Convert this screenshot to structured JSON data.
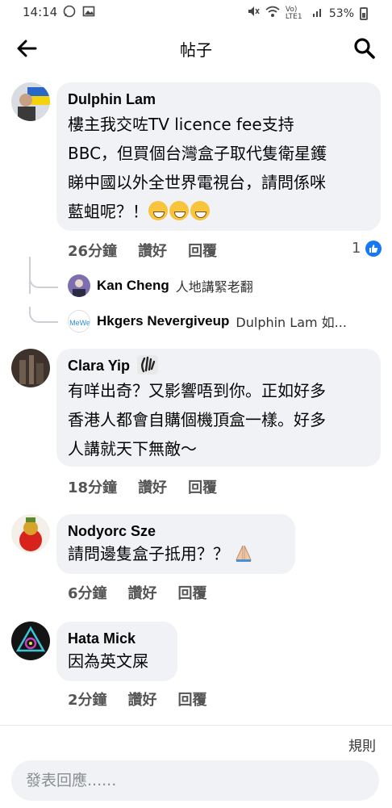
{
  "status_bar": {
    "time": "14:14",
    "network_label": "Vo) LTE1",
    "battery": "53%"
  },
  "header": {
    "title": "帖子"
  },
  "comments": [
    {
      "name": "Dulphin Lam",
      "text_lines": [
        "樓主我交咗TV licence fee支持",
        "BBC，但買個台灣盒子取代隻衛星鑊",
        "睇中國以外全世界電視台，請問係咪",
        "藍蛆呢？！"
      ],
      "time": "26分鐘",
      "like_label": "讚好",
      "reply_label": "回覆",
      "reaction_count": "1"
    },
    {
      "name": "Clara Yip",
      "text_lines": [
        "有咩出奇？又影響唔到你。正如好多",
        "香港人都會自購個機頂盒一樣。好多",
        "人講就天下無敵～"
      ],
      "time": "18分鐘",
      "like_label": "讚好",
      "reply_label": "回覆"
    },
    {
      "name": "Nodyorc Sze",
      "text_lines": [
        "請問邊隻盒子抵用？？"
      ],
      "time": "6分鐘",
      "like_label": "讚好",
      "reply_label": "回覆"
    },
    {
      "name": "Hata Mick",
      "text_lines": [
        "因為英文屎"
      ],
      "time": "2分鐘",
      "like_label": "讚好",
      "reply_label": "回覆"
    }
  ],
  "replies": [
    {
      "name": "Kan Cheng",
      "snippet": "人地講緊老翻"
    },
    {
      "name": "Hkgers Nevergiveup",
      "snippet": "Dulphin Lam 如..."
    }
  ],
  "footer": {
    "rules": "規則",
    "input_placeholder": "發表回應......"
  },
  "colors": {
    "bubble": "#f0f2f5",
    "like_blue": "#1877f2"
  }
}
